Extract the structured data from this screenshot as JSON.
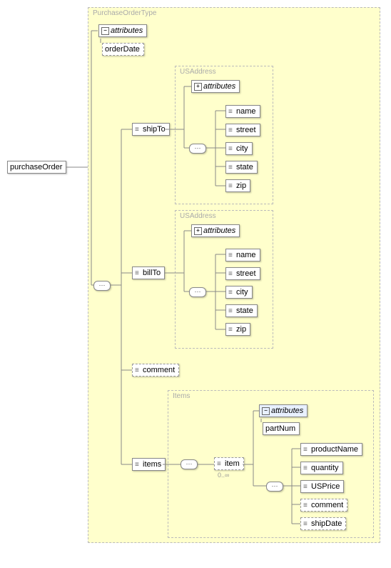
{
  "root": {
    "label": "purchaseOrder"
  },
  "outer_type": {
    "label": "PurchaseOrderType"
  },
  "attributes_label": "attributes",
  "orderDate": {
    "label": "orderDate"
  },
  "shipTo": {
    "label": "shipTo"
  },
  "billTo": {
    "label": "billTo"
  },
  "comment": {
    "label": "comment"
  },
  "items": {
    "label": "items"
  },
  "usaddress": {
    "label": "USAddress",
    "fields": {
      "name": "name",
      "street": "street",
      "city": "city",
      "state": "state",
      "zip": "zip"
    }
  },
  "items_type": {
    "label": "Items",
    "item": "item",
    "item_cardinality": "0..∞",
    "partNum": "partNum",
    "fields": {
      "productName": "productName",
      "quantity": "quantity",
      "usprice": "USPrice",
      "comment": "comment",
      "shipDate": "shipDate"
    }
  },
  "icons": {
    "minus": "−",
    "plus": "+"
  }
}
